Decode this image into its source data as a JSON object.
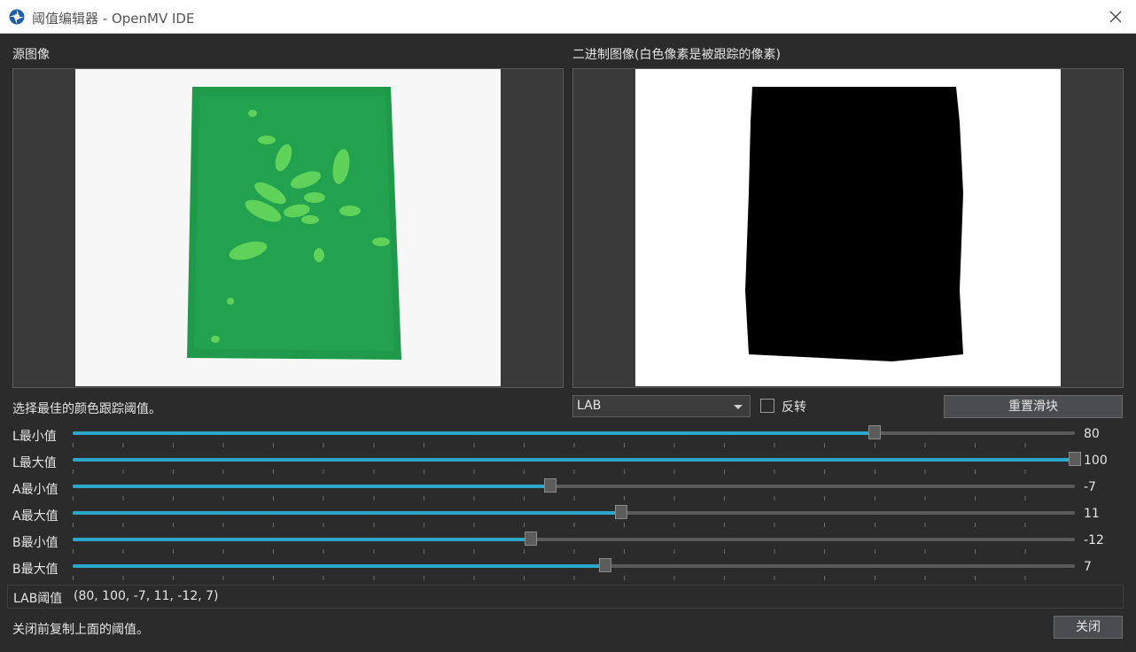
{
  "window": {
    "title": "阈值编辑器 - OpenMV IDE",
    "close_glyph": "✕"
  },
  "source_panel": {
    "label": "源图像"
  },
  "binary_panel": {
    "label": "二进制图像(白色像素是被跟踪的像素)"
  },
  "hint": "选择最佳的颜色跟踪阈值。",
  "color_space": {
    "selected": "LAB"
  },
  "invert": {
    "label": "反转",
    "checked": false
  },
  "reset_button": {
    "label": "重置滑块"
  },
  "sliders": [
    {
      "label": "L最小值",
      "value": "80",
      "fraction": 0.8
    },
    {
      "label": "L最大值",
      "value": "100",
      "fraction": 1.0
    },
    {
      "label": "A最小值",
      "value": "-7",
      "fraction": 0.4766
    },
    {
      "label": "A最大值",
      "value": "11",
      "fraction": 0.5469
    },
    {
      "label": "B最小值",
      "value": "-12",
      "fraction": 0.457
    },
    {
      "label": "B最大值",
      "value": "7",
      "fraction": 0.5313
    }
  ],
  "lab_threshold": {
    "label": "LAB阈值",
    "value": "(80, 100, -7, 11, -12, 7)"
  },
  "footer": {
    "note": "关闭前复制上面的阈值。",
    "close_label": "关闭"
  },
  "colors": {
    "accent": "#2aa7c9",
    "background": "#2b2b2b",
    "board_green": "#1f9a4a",
    "leaf_green": "#5fd25a"
  },
  "icons": [
    "openmv-logo-icon",
    "close-icon",
    "chevron-down-icon"
  ]
}
